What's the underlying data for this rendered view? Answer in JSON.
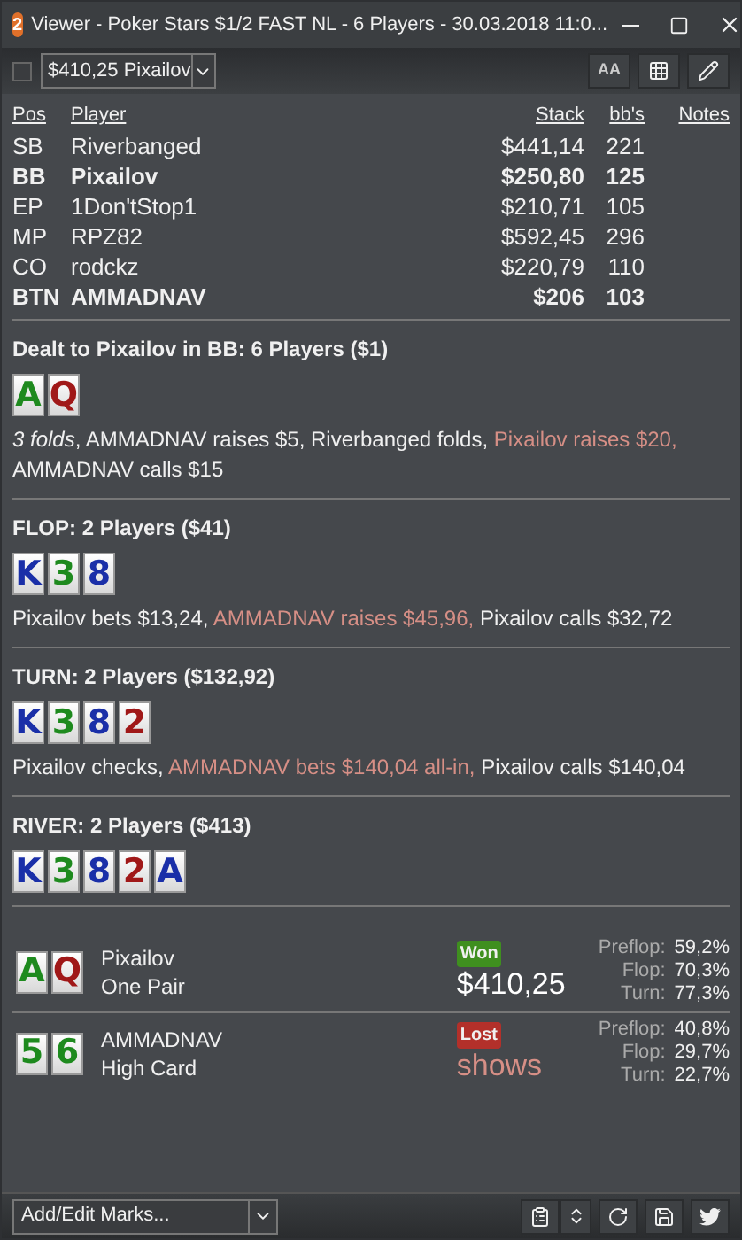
{
  "window": {
    "title": "Viewer - Poker Stars $1/2 FAST NL - 6 Players - 30.03.2018 11:0...",
    "badge": "2"
  },
  "toolbar": {
    "checkbox": {
      "checked": false
    },
    "hand_select": {
      "value": "$410,25 Pixailov"
    },
    "font_button": "AA"
  },
  "players": {
    "columns": [
      "Pos",
      "Player",
      "Stack",
      "bb's",
      "Notes"
    ],
    "rows": [
      {
        "pos": "SB",
        "player": "Riverbanged",
        "stack": "$441,14",
        "bbs": "221",
        "hero": false
      },
      {
        "pos": "BB",
        "player": "Pixailov",
        "stack": "$250,80",
        "bbs": "125",
        "hero": true
      },
      {
        "pos": "EP",
        "player": "1Don'tStop1",
        "stack": "$210,71",
        "bbs": "105",
        "hero": false
      },
      {
        "pos": "MP",
        "player": "RPZ82",
        "stack": "$592,45",
        "bbs": "296",
        "hero": false
      },
      {
        "pos": "CO",
        "player": "rodckz",
        "stack": "$220,79",
        "bbs": "110",
        "hero": false
      },
      {
        "pos": "BTN",
        "player": "AMMADNAV",
        "stack": "$206",
        "bbs": "103",
        "hero": true
      }
    ]
  },
  "streets": [
    {
      "heading": "Dealt to Pixailov in BB: 6 Players ($1)",
      "cards": [
        {
          "rank": "A",
          "color": "#1e8a1e"
        },
        {
          "rank": "Q",
          "color": "#a01818"
        }
      ],
      "actions": [
        {
          "text": "*3 folds*, AMMADNAV raises $5, Riverbanged folds,",
          "highlight": false
        },
        {
          "text": "Pixailov raises $20,",
          "highlight": true
        },
        {
          "text": "AMMADNAV calls $15",
          "highlight": false
        }
      ]
    },
    {
      "heading": "FLOP: 2 Players ($41)",
      "cards": [
        {
          "rank": "K",
          "color": "#1a2fa8"
        },
        {
          "rank": "3",
          "color": "#1e8a1e"
        },
        {
          "rank": "8",
          "color": "#1a2fa8"
        }
      ],
      "actions": [
        {
          "text": "Pixailov bets $13,24,",
          "highlight": false
        },
        {
          "text": "AMMADNAV raises $45,96,",
          "highlight": true
        },
        {
          "text": "Pixailov calls $32,72",
          "highlight": false
        }
      ]
    },
    {
      "heading": "TURN: 2 Players ($132,92)",
      "cards": [
        {
          "rank": "K",
          "color": "#1a2fa8"
        },
        {
          "rank": "3",
          "color": "#1e8a1e"
        },
        {
          "rank": "8",
          "color": "#1a2fa8"
        },
        {
          "rank": "2",
          "color": "#a01818"
        }
      ],
      "actions": [
        {
          "text": "Pixailov checks,",
          "highlight": false
        },
        {
          "text": "AMMADNAV bets $140,04 all-in,",
          "highlight": true
        },
        {
          "text": "Pixailov calls $140,04",
          "highlight": false
        }
      ]
    },
    {
      "heading": "RIVER: 2 Players ($413)",
      "cards": [
        {
          "rank": "K",
          "color": "#1a2fa8"
        },
        {
          "rank": "3",
          "color": "#1e8a1e"
        },
        {
          "rank": "8",
          "color": "#1a2fa8"
        },
        {
          "rank": "2",
          "color": "#a01818"
        },
        {
          "rank": "A",
          "color": "#1a2fa8"
        }
      ]
    }
  ],
  "results": [
    {
      "cards": [
        {
          "rank": "A",
          "color": "#1e8a1e"
        },
        {
          "rank": "Q",
          "color": "#a01818"
        }
      ],
      "player": "Pixailov",
      "hand": "One Pair",
      "outcome": "Won",
      "kind": "won",
      "amount": "$410,25",
      "equity": [
        {
          "label": "Preflop:",
          "value": "59,2%"
        },
        {
          "label": "Flop:",
          "value": "70,3%"
        },
        {
          "label": "Turn:",
          "value": "77,3%"
        }
      ]
    },
    {
      "cards": [
        {
          "rank": "5",
          "color": "#1e8a1e"
        },
        {
          "rank": "6",
          "color": "#1e8a1e"
        }
      ],
      "player": "AMMADNAV",
      "hand": "High Card",
      "outcome": "Lost",
      "kind": "lost",
      "amount": "shows",
      "equity": [
        {
          "label": "Preflop:",
          "value": "40,8%"
        },
        {
          "label": "Flop:",
          "value": "29,7%"
        },
        {
          "label": "Turn:",
          "value": "22,7%"
        }
      ]
    }
  ],
  "bottom_bar": {
    "marks_select": {
      "value": "Add/Edit Marks..."
    }
  }
}
